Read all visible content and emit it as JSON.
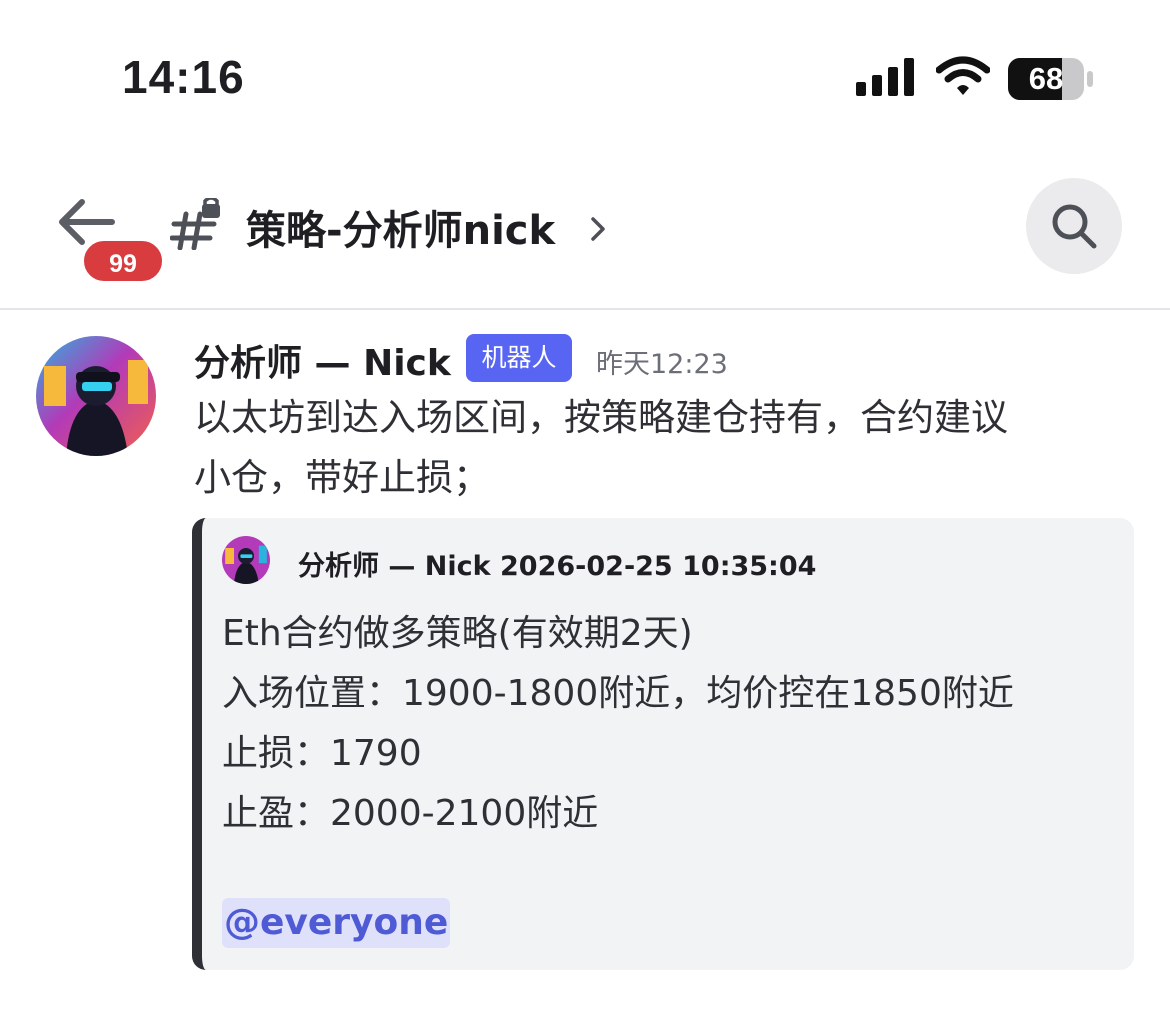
{
  "status_bar": {
    "time": "14:16",
    "battery_level": "68",
    "signal_icon": "cellular-signal-icon",
    "wifi_icon": "wifi-icon",
    "battery_icon": "battery-icon"
  },
  "header": {
    "unread_count": "99",
    "channel_name": "策略-分析师nick",
    "back_icon": "arrow-left-icon",
    "channel_icon": "locked-hashtag-icon",
    "chevron_icon": "chevron-right-icon",
    "search_icon": "search-icon"
  },
  "message": {
    "author": "分析师 — Nick",
    "bot_tag": "机器人",
    "timestamp": "昨天12:23",
    "body_line1": "以太坊到达入场区间，按策略建仓持有，合约建议",
    "body_line2": "小仓，带好止损；",
    "embed": {
      "author_line": "分析师 — Nick 2026-02-25 10:35:04",
      "lines": [
        "Eth合约做多策略(有效期2天)",
        "入场位置：1900-1800附近，均价控在1850附近",
        "止损：1790",
        "止盈：2000-2100附近"
      ],
      "mention": "@everyone",
      "accent_color": "#2e3035"
    }
  },
  "colors": {
    "badge_red": "#d83c3e",
    "bot_tag_blurple": "#5865f2",
    "mention_bg": "#dfe1fb",
    "mention_text": "#4e5bd4"
  }
}
